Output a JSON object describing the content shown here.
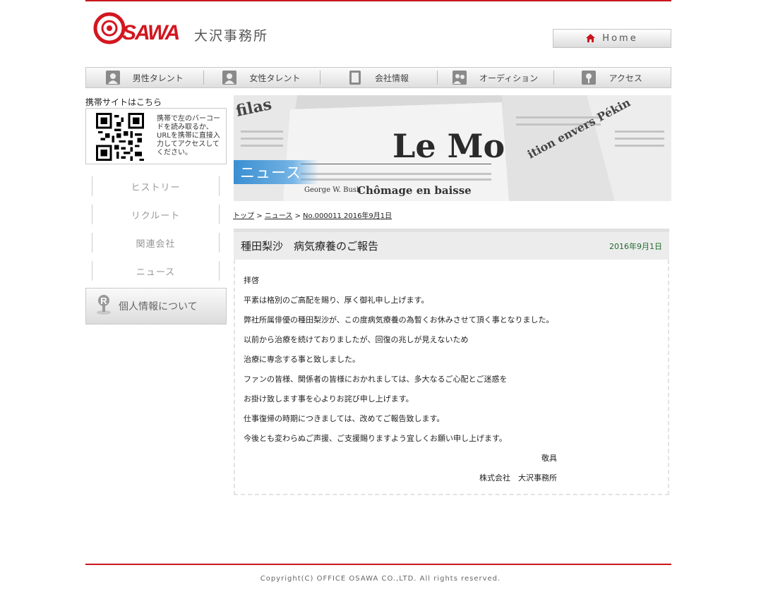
{
  "header": {
    "logo_text": "OSAWA",
    "site_name": "大沢事務所",
    "home_label": "Home"
  },
  "nav": [
    {
      "label": "男性タレント",
      "icon": "person-icon"
    },
    {
      "label": "女性タレント",
      "icon": "person-icon"
    },
    {
      "label": "会社情報",
      "icon": "document-icon"
    },
    {
      "label": "オーディション",
      "icon": "audition-icon"
    },
    {
      "label": "アクセス",
      "icon": "map-pin-icon"
    }
  ],
  "sidebar": {
    "mobile_title": "携帯サイトはこちら",
    "qr_text": "携帯で左のバーコードを読み取るか、URLを携帯に直接入力してアクセスしてください。",
    "links": [
      "ヒストリー",
      "リクルート",
      "関連会社",
      "ニュース"
    ],
    "privacy_label": "個人情報について"
  },
  "hero": {
    "label": "ニュース"
  },
  "breadcrumb": {
    "items": [
      "トップ",
      "ニュース",
      "No.000011 2016年9月1日"
    ],
    "separator": ">"
  },
  "article": {
    "title": "種田梨沙　病気療養のご報告",
    "date": "2016年9月1日",
    "lines": [
      "拝啓",
      "平素は格別のご高配を賜り、厚く御礼申し上げます。",
      "弊社所属俳優の種田梨沙が、この度病気療養の為暫くお休みさせて頂く事となりました。",
      "以前から治療を続けておりましたが、回復の兆しが見えないため",
      "治療に専念する事と致しました。",
      "ファンの皆様、関係者の皆様におかれましては、多大なるご心配とご迷惑を",
      "お掛け致します事を心よりお詫び申し上げます。",
      "仕事復帰の時期につきましては、改めてご報告致します。",
      "今後とも変わらぬご声援、ご支援賜りますよう宜しくお願い申し上げます。"
    ],
    "closing": "敬具",
    "signature": "株式会社　大沢事務所"
  },
  "footer": {
    "copyright": "Copyright(C) OFFICE OSAWA CO.,LTD. All rights reserved."
  },
  "colors": {
    "brand_red": "#c8161d",
    "date_green": "#1f6a2d",
    "banner_blue": "#3a8fd2"
  }
}
